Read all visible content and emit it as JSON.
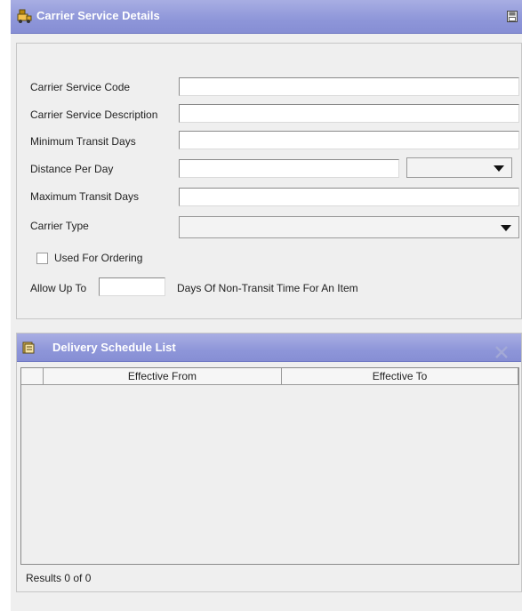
{
  "header": {
    "title": "Carrier Service Details",
    "icon": "carrier-icon",
    "action_icon": "save-icon"
  },
  "form": {
    "carrier_service_code": {
      "label": "Carrier Service Code",
      "value": ""
    },
    "carrier_service_description": {
      "label": "Carrier Service Description",
      "value": ""
    },
    "minimum_transit_days": {
      "label": "Minimum Transit Days",
      "value": ""
    },
    "distance_per_day": {
      "label": "Distance Per Day",
      "value": "",
      "unit_selected": ""
    },
    "maximum_transit_days": {
      "label": "Maximum Transit Days",
      "value": ""
    },
    "carrier_type": {
      "label": "Carrier Type",
      "selected": ""
    },
    "used_for_ordering": {
      "label": "Used For Ordering",
      "checked": false
    },
    "allow_up_to": {
      "label": "Allow Up To",
      "value": "",
      "suffix": "Days Of Non-Transit Time For An Item"
    }
  },
  "delivery_schedule": {
    "title": "Delivery Schedule List",
    "icon": "book-icon",
    "close_icon": "close-icon",
    "columns": [
      "Effective From",
      "Effective To"
    ],
    "rows": [],
    "results_text": "Results 0 of 0"
  },
  "colors": {
    "header_gradient_top": "#a8aee3",
    "header_gradient_bottom": "#868ed4",
    "panel_bg": "#efefef"
  }
}
